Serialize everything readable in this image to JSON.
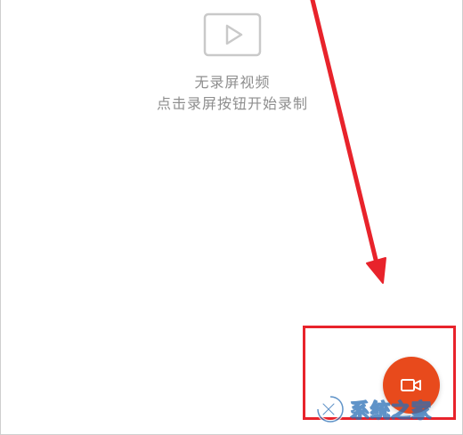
{
  "empty_state": {
    "icon": "video-play-icon",
    "title": "无录屏视频",
    "subtitle": "点击录屏按钮开始录制"
  },
  "record_button": {
    "icon": "video-camera-icon",
    "color": "#e84a1c"
  },
  "annotation": {
    "arrow_color": "#e8232b",
    "box_color": "#e8232b"
  },
  "watermark": {
    "text": "系统之家"
  }
}
